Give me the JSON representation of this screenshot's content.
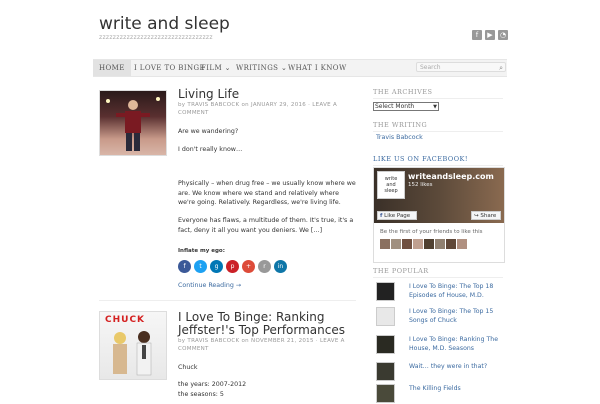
{
  "site": {
    "title": "write and sleep",
    "tagline": "zzzzzzzzzzzzzzzzzzzzzzzzzzzzzzzzz"
  },
  "social_icons": [
    "facebook-icon",
    "youtube-icon",
    "rss-icon"
  ],
  "nav": {
    "items": [
      {
        "label": "HOME",
        "active": true
      },
      {
        "label": "I LOVE TO BINGE"
      },
      {
        "label": "FILM ⌄"
      },
      {
        "label": "WRITINGS ⌄"
      },
      {
        "label": "WHAT I KNOW"
      }
    ],
    "search_placeholder": "Search"
  },
  "posts": [
    {
      "title": "Living Life",
      "meta_by": "by",
      "meta_author": "TRAVIS BABCOCK",
      "meta_on": "on",
      "meta_date": "JANUARY 29, 2016",
      "meta_leave": "· LEAVE A COMMENT",
      "paragraphs": [
        "Are we wandering?",
        "I don't really know…",
        "Physically – when drug free – we usually know where we are. We know where we stand and relatively where we're going. Relatively. Regardless, we're living life.",
        "Everyone has flaws, a multitude of them. It's true, it's a fact, deny it all you want you deniers. We […]"
      ],
      "share_label": "Inflate my ego:",
      "continue": "Continue Reading →"
    },
    {
      "title": "I Love To Binge: Ranking Jeffster!'s Top Performances",
      "meta_by": "by",
      "meta_author": "TRAVIS BABCOCK",
      "meta_on": "on",
      "meta_date": "NOVEMBER 21, 2015",
      "meta_leave": "· LEAVE A COMMENT",
      "thumb_text": "CHUCK",
      "paragraphs": [
        "Chuck",
        "the years: 2007-2012",
        "the seasons: 5"
      ]
    }
  ],
  "share_colors": [
    "#3b5998",
    "#1da1f2",
    "#0077b5",
    "#cb2027",
    "#dd4b39",
    "#999999",
    "#3b5998"
  ],
  "sidebar": {
    "archives_heading": "THE ARCHIVES",
    "archives_select": "Select Month",
    "writing_heading": "THE WRITING",
    "writing_link": "Travis Babcock",
    "facebook_heading": "LIKE US ON FACEBOOK!",
    "fb": {
      "page_name": "writeandsleep.com",
      "likes": "152 likes",
      "like_button": "Like Page",
      "share_button": "Share",
      "friends_text": "Be the first of your friends to like this",
      "logo_text_1": "write",
      "logo_text_2": "and",
      "logo_text_3": "sleep"
    },
    "popular_heading": "THE POPULAR",
    "popular": [
      "I Love To Binge: The Top 18 Episodes of House, M.D.",
      "I Love To Binge: The Top 15 Songs of Chuck",
      "I Love To Binge: Ranking The House, M.D. Seasons",
      "Wait… they were in that?",
      "The Killing Fields"
    ]
  }
}
